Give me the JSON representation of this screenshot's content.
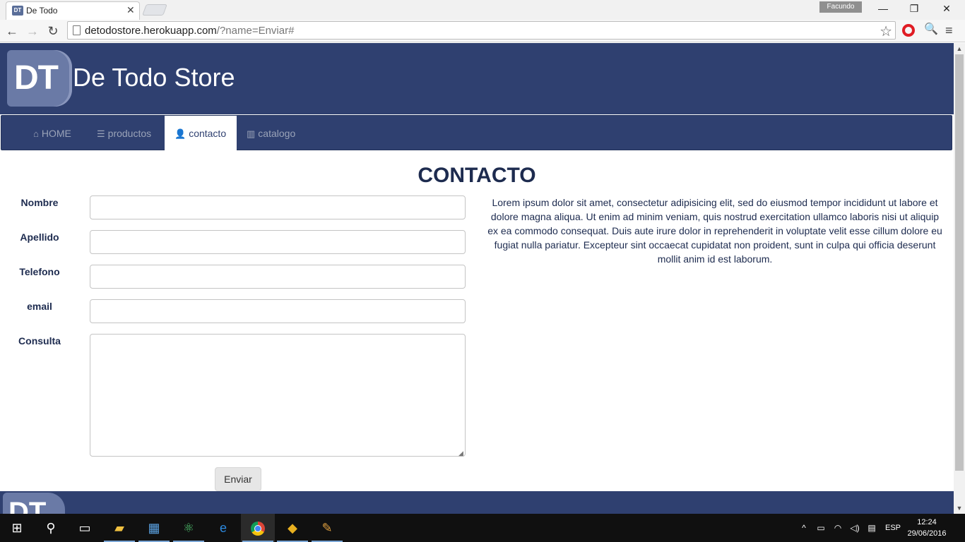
{
  "browser": {
    "tab_title": "De Todo",
    "tab_favicon": "DT",
    "close_glyph": "✕",
    "profile_name": "Facundo",
    "url_host": "detodostore.herokuapp.com",
    "url_rest": "/?name=Enviar#",
    "window_min": "—",
    "window_max": "❐",
    "window_close": "✕",
    "back_glyph": "←",
    "forward_glyph": "→",
    "reload_glyph": "↻",
    "star_glyph": "☆",
    "search_glyph": "🔍",
    "menu_glyph": "≡"
  },
  "site": {
    "logo_text": "DT",
    "title": "De Todo Store",
    "nav": [
      {
        "label": "HOME",
        "icon": "home-icon",
        "glyph": "⌂"
      },
      {
        "label": "productos",
        "icon": "list-icon",
        "glyph": "☰"
      },
      {
        "label": "contacto",
        "icon": "user-icon",
        "glyph": "👤"
      },
      {
        "label": "catalogo",
        "icon": "barcode-icon",
        "glyph": "▥"
      }
    ],
    "heading": "CONTACTO"
  },
  "form": {
    "nombre_label": "Nombre",
    "apellido_label": "Apellido",
    "telefono_label": "Telefono",
    "email_label": "email",
    "consulta_label": "Consulta",
    "nombre_value": "",
    "apellido_value": "",
    "telefono_value": "",
    "email_value": "",
    "consulta_value": "",
    "submit_label": "Enviar"
  },
  "lorem": "Lorem ipsum dolor sit amet, consectetur adipisicing elit, sed do eiusmod tempor incididunt ut labore et dolore magna aliqua. Ut enim ad minim veniam, quis nostrud exercitation ullamco laboris nisi ut aliquip ex ea commodo consequat. Duis aute irure dolor in reprehenderit in voluptate velit esse cillum dolore eu fugiat nulla pariatur. Excepteur sint occaecat cupidatat non proident, sunt in culpa qui officia deserunt mollit anim id est laborum.",
  "footer": {
    "logo_text": "DT"
  },
  "taskbar": {
    "start_glyph": "⊞",
    "search_glyph": "⚲",
    "taskview_glyph": "▭",
    "explorer_glyph": "▰",
    "store_glyph": "▦",
    "atom_glyph": "⚛",
    "edge_glyph": "e",
    "git_glyph": "◆",
    "paint_glyph": "✎",
    "tray_chevron": "^",
    "tray_battery": "▭",
    "tray_wifi": "◠",
    "tray_volume": "◁)",
    "tray_notes": "▤",
    "language": "ESP",
    "time": "12:24",
    "date": "29/06/2016"
  },
  "colors": {
    "brand": "#2f4070",
    "heading": "#1d2b4f",
    "taskbar": "#101010"
  }
}
